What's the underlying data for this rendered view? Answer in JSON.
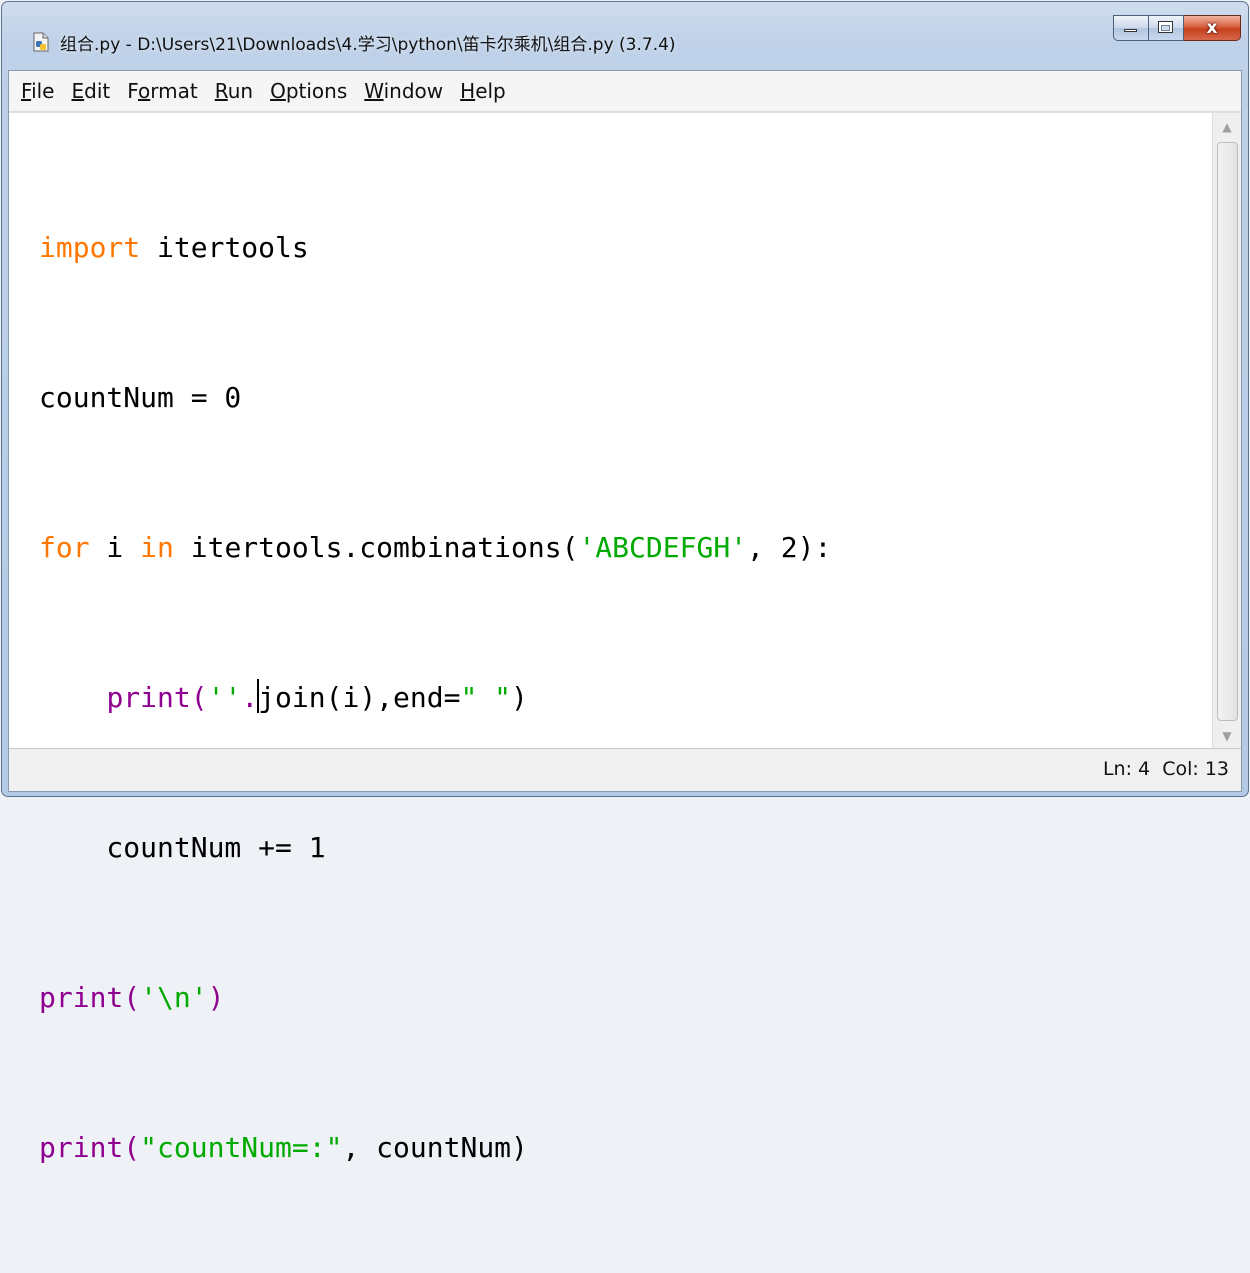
{
  "window": {
    "title": "组合.py - D:\\Users\\21\\Downloads\\4.学习\\python\\笛卡尔乘机\\组合.py (3.7.4)",
    "controls": {
      "minimize": "minimize",
      "maximize": "maximize",
      "close": "x"
    }
  },
  "menu": [
    {
      "accel": "F",
      "rest": "ile"
    },
    {
      "accel": "E",
      "rest": "dit"
    },
    {
      "pre": "F",
      "accel": "o",
      "rest": "rmat"
    },
    {
      "accel": "R",
      "rest": "un"
    },
    {
      "accel": "O",
      "rest": "ptions"
    },
    {
      "accel": "W",
      "rest": "indow"
    },
    {
      "accel": "H",
      "rest": "elp"
    }
  ],
  "code": {
    "l1": {
      "kw": "import",
      "rest": " itertools"
    },
    "l2": {
      "text": "countNum = 0"
    },
    "l3": {
      "kw1": "for",
      "mid1": " i ",
      "kw2": "in",
      "mid2": " itertools.combinations(",
      "str": "'ABCDEFGH'",
      "tail": ", 2):"
    },
    "l4": {
      "indent": "    ",
      "fn": "print",
      "p1": "(",
      "str1": "''",
      "dot": ".",
      "mid": "join(i),end=",
      "str2": "\" \"",
      "tail": ")"
    },
    "l5": {
      "text": "    countNum += 1"
    },
    "l6": {
      "fn": "print",
      "p1": "(",
      "str": "'\\n'",
      "tail": ")"
    },
    "l7": {
      "fn": "print",
      "p1": "(",
      "str": "\"countNum=:\"",
      "tail": ", countNum)"
    }
  },
  "status": {
    "line": "Ln: 4",
    "col": "Col: 13"
  },
  "icons": {
    "app": "python-file-icon"
  },
  "colors": {
    "keyword": "#ff7700",
    "builtin": "#900090",
    "string": "#00aa00",
    "close_button": "#c7401e"
  }
}
